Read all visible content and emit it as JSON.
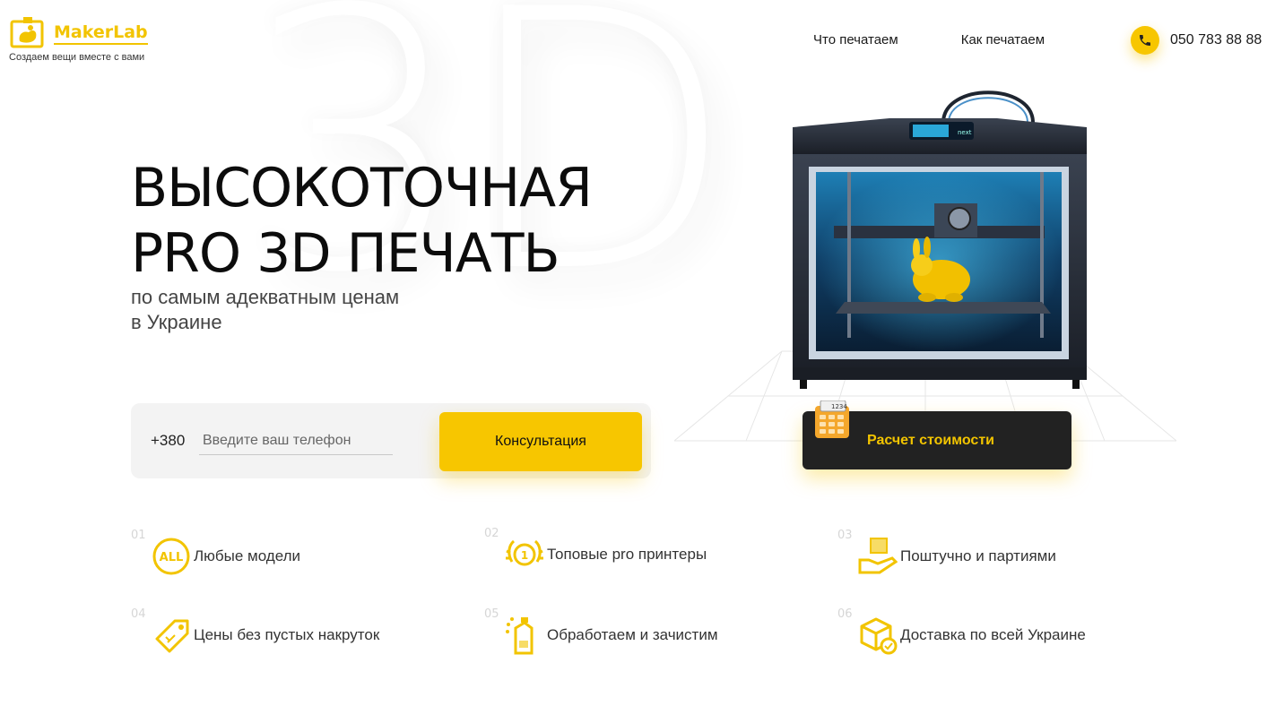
{
  "brand": {
    "name": "MakerLab",
    "tagline": "Создаем вещи вместе с вами",
    "accent_color": "#f7c600",
    "dark_color": "#222222"
  },
  "watermark": "3D",
  "nav": {
    "items": [
      {
        "label": "Что печатаем"
      },
      {
        "label": "Как печатаем"
      }
    ]
  },
  "contact": {
    "phone": "050 783 88 88",
    "icon": "phone-icon"
  },
  "hero": {
    "title_line1": "ВЫСОКОТОЧНАЯ",
    "title_line2": "PRO 3D ПЕЧАТЬ",
    "subtitle_line1": "по самым адекватным ценам",
    "subtitle_line2": "в Украине"
  },
  "form": {
    "prefix": "+380",
    "placeholder": "Введите ваш телефон",
    "value": "",
    "submit_label": "Консультация"
  },
  "calculator": {
    "label": "Расчет стоимости",
    "display": "1234",
    "icon": "calculator-icon"
  },
  "printer": {
    "screen_text": "next",
    "icon": "3d-printer-image"
  },
  "features": [
    {
      "num": "01",
      "label": "Любые модели",
      "icon": "all-badge-icon",
      "badge": "ALL"
    },
    {
      "num": "02",
      "label": "Топовые pro принтеры",
      "icon": "award-medal-icon",
      "badge": "1"
    },
    {
      "num": "03",
      "label": "Поштучно и партиями",
      "icon": "box-in-hand-icon"
    },
    {
      "num": "04",
      "label": "Цены без пустых накруток",
      "icon": "price-tag-icon"
    },
    {
      "num": "05",
      "label": "Обработаем и зачистим",
      "icon": "spray-cleaning-icon"
    },
    {
      "num": "06",
      "label": "Доставка по всей Украине",
      "icon": "delivery-box-icon"
    }
  ]
}
